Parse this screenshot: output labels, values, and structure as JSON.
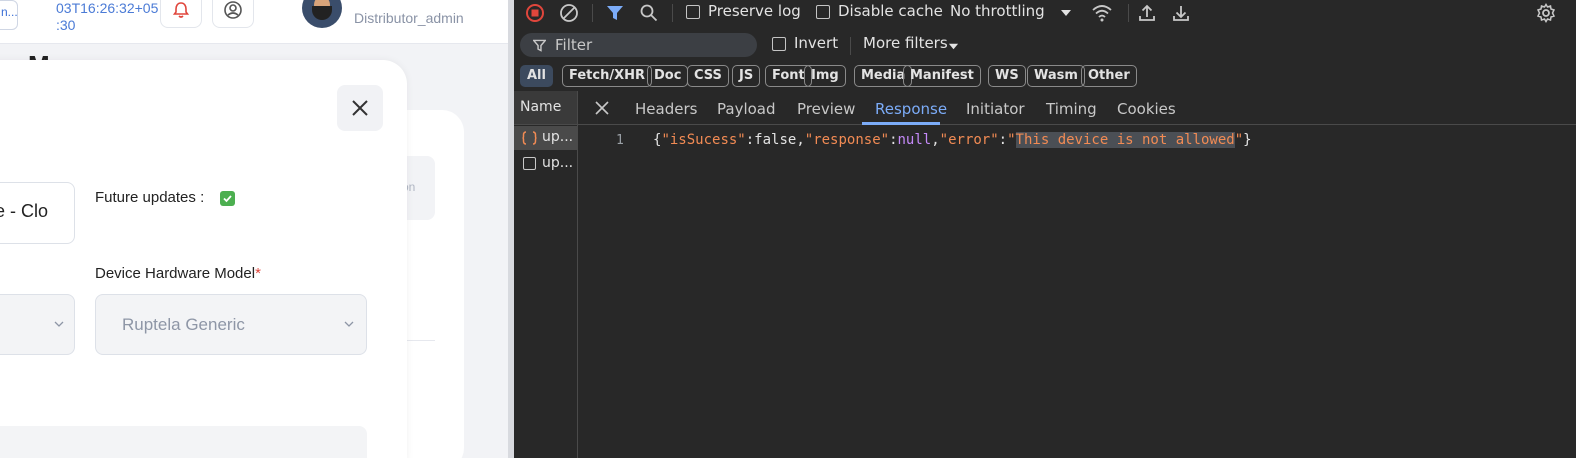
{
  "app": {
    "topbar": {
      "truncated_chip": "n...",
      "datetime": "03T16:26:32+05\n:30",
      "user_name": "...",
      "user_role": "Distributor_admin"
    },
    "bg": {
      "heading": "M",
      "chip_text": "on"
    },
    "modal": {
      "text_field_value": "e - Clo",
      "future_updates_label": "Future updates :",
      "future_updates_checked": true,
      "hardware_label": "Device Hardware Model",
      "required_mark": "*",
      "hardware_value": "Ruptela Generic"
    }
  },
  "devtools": {
    "toolbar": {
      "preserve_log": "Preserve log",
      "disable_cache": "Disable cache",
      "throttling": "No throttling"
    },
    "filter_row": {
      "filter_placeholder": "Filter",
      "invert": "Invert",
      "more_filters": "More filters"
    },
    "type_chips": [
      "All",
      "Fetch/XHR",
      "Doc",
      "CSS",
      "JS",
      "Font",
      "Img",
      "Media",
      "Manifest",
      "WS",
      "Wasm",
      "Other"
    ],
    "name_header": "Name",
    "requests": [
      {
        "name": "up...",
        "selected": true
      },
      {
        "name": "up...",
        "selected": false
      }
    ],
    "tabs": [
      "Headers",
      "Payload",
      "Preview",
      "Response",
      "Initiator",
      "Timing",
      "Cookies"
    ],
    "active_tab": "Response",
    "response": {
      "line_number": "1",
      "open_brace": "{",
      "key1": "\"isSucess\"",
      "val1": "false",
      "key2": "\"response\"",
      "val2": "null",
      "key3": "\"error\"",
      "val3_quote_open": "\"",
      "val3_text": "This device is not allowed",
      "val3_quote_close": "\"",
      "close_brace": "}"
    },
    "colors": {
      "bg": "#282828",
      "accent": "#7cacf8",
      "string": "#f28b54",
      "keyword": "#c58af9",
      "record": "#e0463c"
    }
  }
}
